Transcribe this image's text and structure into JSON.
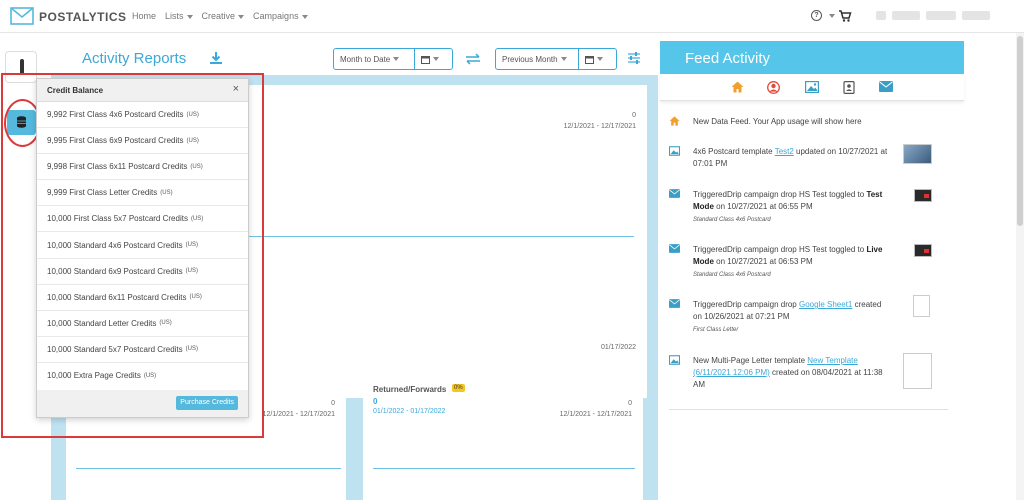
{
  "app": {
    "brand": "POSTALYTICS"
  },
  "nav": {
    "home": "Home",
    "lists": "Lists",
    "creative": "Creative",
    "campaigns": "Campaigns",
    "help": "?"
  },
  "activity": {
    "title": "Activity Reports",
    "range_select": "Month to Date",
    "compare_select": "Previous Month",
    "main_card": {
      "value": "0",
      "range": "12/1/2021 - 12/17/2021",
      "end_date": "01/17/2022"
    },
    "card_bottom_left": {
      "value": "0",
      "range": "12/1/2021 - 12/17/2021"
    },
    "card_returned": {
      "title": "Returned/Forwards",
      "badge": "0%",
      "count": "0",
      "range_link": "01/1/2022 - 01/17/2022",
      "value": "0",
      "range": "12/1/2021 - 12/17/2021"
    }
  },
  "credit_balance": {
    "title": "Credit Balance",
    "close": "×",
    "items": [
      {
        "label": "9,992 First Class 4x6 Postcard Credits",
        "region": "(US)"
      },
      {
        "label": "9,995 First Class 6x9 Postcard Credits",
        "region": "(US)"
      },
      {
        "label": "9,998 First Class 6x11 Postcard Credits",
        "region": "(US)"
      },
      {
        "label": "9,999 First Class Letter Credits",
        "region": "(US)"
      },
      {
        "label": "10,000 First Class 5x7 Postcard Credits",
        "region": "(US)"
      },
      {
        "label": "10,000 Standard 4x6 Postcard Credits",
        "region": "(US)"
      },
      {
        "label": "10,000 Standard 6x9 Postcard Credits",
        "region": "(US)"
      },
      {
        "label": "10,000 Standard 6x11 Postcard Credits",
        "region": "(US)"
      },
      {
        "label": "10,000 Standard Letter Credits",
        "region": "(US)"
      },
      {
        "label": "10,000 Standard 5x7 Postcard Credits",
        "region": "(US)"
      },
      {
        "label": "10,000 Extra Page Credits",
        "region": "(US)"
      }
    ],
    "purchase_label": "Purchase Credits"
  },
  "feed": {
    "title": "Feed Activity",
    "item1": {
      "text": "New Data Feed. Your App usage will show here"
    },
    "item2": {
      "pre": "4x6 Postcard template ",
      "link": "Test2",
      "post": " updated on 10/27/2021 at 07:01 PM"
    },
    "item3": {
      "pre": "TriggeredDrip campaign drop HS Test toggled to ",
      "bold": "Test Mode",
      "post": " on 10/27/2021 at 06:55 PM",
      "sub": "Standard Class 4x6 Postcard"
    },
    "item4": {
      "pre": "TriggeredDrip campaign drop HS Test toggled to ",
      "bold": "Live Mode",
      "post": " on 10/27/2021 at 06:53 PM",
      "sub": "Standard Class 4x6 Postcard"
    },
    "item5": {
      "pre": "TriggeredDrip campaign drop ",
      "link": "Google Sheet1",
      "post": " created on 10/26/2021 at 07:21 PM",
      "sub": "First Class Letter"
    },
    "item6": {
      "pre": "New Multi-Page Letter template ",
      "link": "New Template (6/11/2021 12:06 PM)",
      "post": " created on 08/04/2021 at 11:38 AM"
    }
  },
  "colors": {
    "accent": "#3aa8d8",
    "feed_header": "#55c5e9",
    "highlight": "#dc3a3a",
    "panel_bg": "#bfe2f1"
  }
}
